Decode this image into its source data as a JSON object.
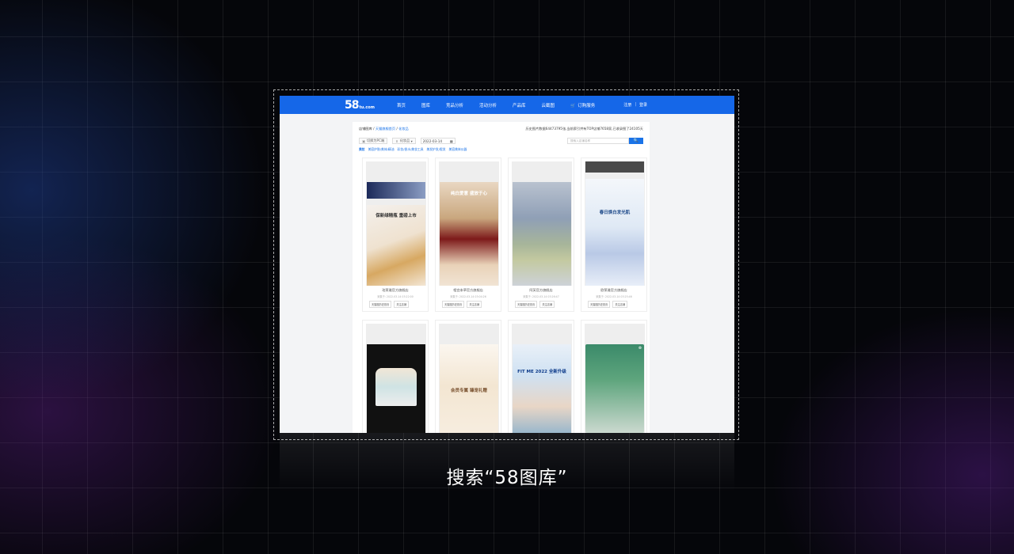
{
  "site": {
    "logo_big": "58",
    "logo_small": "tu.com",
    "nav": [
      "首页",
      "图库",
      "竞品分析",
      "活动分析",
      "产品库",
      "云截图",
      "订购服务"
    ],
    "auth": {
      "register": "注册",
      "sep": "|",
      "login": "登录"
    }
  },
  "breadcrumb": {
    "root": "店铺图库",
    "sep1": "/",
    "mid": "天猫旗舰首页",
    "sep2": "/",
    "current": "化妆品"
  },
  "info": "历史图片数据64473795张,当前索引并有TOP店铺7658家,已收录图了24105天",
  "tools": {
    "switch_label": "切换为PC端",
    "category_label": "化妆品",
    "date_value": "2022-03-14",
    "search_placeholder": "搜索入店铺名称",
    "search_button": "🔍"
  },
  "tags": [
    "美妆",
    "美容护肤/美体/精油",
    "彩妆/香水/美妆工具",
    "美发护发/假发",
    "美容美体仪器"
  ],
  "cards_row1": [
    {
      "name": "珀莱雅官方旗舰店",
      "time": "采集于: 2022-03-14 03:22:00",
      "btn1": "天猫图历史首页",
      "btn2": "关注店铺",
      "slogan": "保新绿精瓶 重磅上市",
      "brand": "PROYA"
    },
    {
      "name": "相宜本草官方旗舰店",
      "time": "采集于: 2022-03-14 03:04:26",
      "btn1": "天猫图历史首页",
      "btn2": "关注店铺",
      "slogan": "纯白爱意 盛放于心",
      "brand": ""
    },
    {
      "name": "阿芙官方旗舰店",
      "time": "采集于: 2022-03-14 03:26:47",
      "btn1": "天猫图历史首页",
      "btn2": "关注店铺",
      "slogan": "",
      "brand": ""
    },
    {
      "name": "欧莱雅官方旗舰店",
      "time": "采集于: 2022-03-14 03:25:46",
      "btn1": "天猫图历史首页",
      "btn2": "关注店铺",
      "slogan": "春日焕白发光肌",
      "brand": "L'OREAL"
    }
  ],
  "cards_row2": [
    {
      "slogan": ""
    },
    {
      "slogan": "会员专属 臻宠礼赠"
    },
    {
      "slogan": "FIT ME 2022 全新升级"
    },
    {
      "slogan": ""
    }
  ],
  "caption": "搜索“58图库”",
  "colors": {
    "brand_blue": "#1567e8",
    "link_blue": "#1a73e8"
  }
}
